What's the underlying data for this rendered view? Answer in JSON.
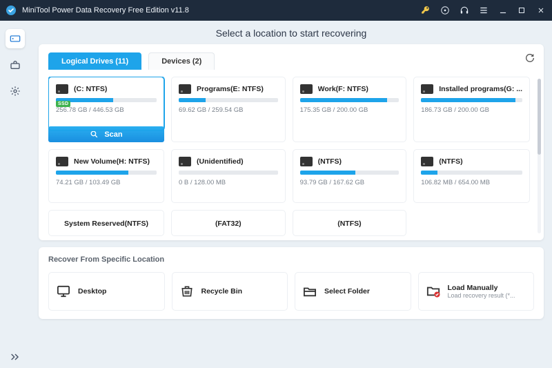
{
  "titlebar": {
    "title": "MiniTool Power Data Recovery Free Edition v11.8"
  },
  "heading": "Select a location to start recovering",
  "tabs": {
    "logical": "Logical Drives (11)",
    "devices": "Devices (2)"
  },
  "scan_label": "Scan",
  "drives": [
    {
      "name": "(C: NTFS)",
      "size": "256.78 GB / 446.53 GB",
      "pct": 57,
      "ssd": true
    },
    {
      "name": "Programs(E: NTFS)",
      "size": "69.62 GB / 259.54 GB",
      "pct": 27
    },
    {
      "name": "Work(F: NTFS)",
      "size": "175.35 GB / 200.00 GB",
      "pct": 88
    },
    {
      "name": "Installed programs(G: ...",
      "size": "186.73 GB / 200.00 GB",
      "pct": 93
    },
    {
      "name": "New Volume(H: NTFS)",
      "size": "74.21 GB / 103.49 GB",
      "pct": 72
    },
    {
      "name": "(Unidentified)",
      "size": "0 B / 128.00 MB",
      "pct": 0
    },
    {
      "name": "(NTFS)",
      "size": "93.79 GB / 167.62 GB",
      "pct": 56
    },
    {
      "name": "(NTFS)",
      "size": "106.82 MB / 654.00 MB",
      "pct": 16
    },
    {
      "name": "System Reserved(NTFS)",
      "noDetail": true
    },
    {
      "name": "(FAT32)",
      "noDetail": true
    },
    {
      "name": "(NTFS)",
      "noDetail": true
    }
  ],
  "locations": {
    "section_title": "Recover From Specific Location",
    "items": [
      {
        "name": "Desktop"
      },
      {
        "name": "Recycle Bin"
      },
      {
        "name": "Select Folder"
      },
      {
        "name": "Load Manually",
        "sub": "Load recovery result (*..."
      }
    ]
  },
  "ssd_badge": "SSD"
}
